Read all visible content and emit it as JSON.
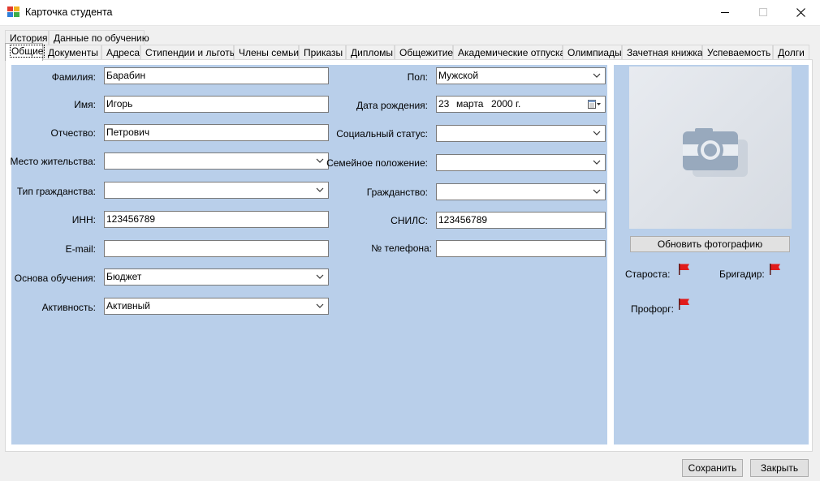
{
  "window": {
    "title": "Карточка студента",
    "colors": {
      "panel_bg": "#b9cfea",
      "window_bg": "#f0f0f0"
    }
  },
  "tabs_top": [
    "История",
    "Данные по обучению"
  ],
  "tabs_main": [
    "Общие",
    "Документы",
    "Адреса",
    "Стипендии и льготы",
    "Члены семьи",
    "Приказы",
    "Дипломы",
    "Общежитие",
    "Академические отпуска",
    "Олимпиады",
    "Зачетная книжка",
    "Успеваемость",
    "Долги"
  ],
  "active_tab": "Общие",
  "form": {
    "surname": {
      "label": "Фамилия:",
      "value": "Барабин"
    },
    "name": {
      "label": "Имя:",
      "value": "Игорь"
    },
    "patronymic": {
      "label": "Отчество:",
      "value": "Петрович"
    },
    "residence": {
      "label": "Место жительства:",
      "value": ""
    },
    "citizenship_type": {
      "label": "Тип гражданства:",
      "value": ""
    },
    "inn": {
      "label": "ИНН:",
      "value": "123456789"
    },
    "email": {
      "label": "E-mail:",
      "value": ""
    },
    "study_basis": {
      "label": "Основа обучения:",
      "value": "Бюджет"
    },
    "activity": {
      "label": "Активность:",
      "value": "Активный"
    },
    "gender": {
      "label": "Пол:",
      "value": "Мужской"
    },
    "birth_date": {
      "label": "Дата рождения:",
      "day": "23",
      "month": "марта",
      "year": "2000 г."
    },
    "social_status": {
      "label": "Социальный статус:",
      "value": ""
    },
    "marital_status": {
      "label": "Семейное положение:",
      "value": ""
    },
    "citizenship": {
      "label": "Гражданство:",
      "value": ""
    },
    "snils": {
      "label": "СНИЛС:",
      "value": "123456789"
    },
    "phone": {
      "label": "№ телефона:",
      "value": ""
    }
  },
  "photo": {
    "update_button": "Обновить фотографию",
    "icon": "camera-icon"
  },
  "roles": {
    "headman": "Староста:",
    "brigadier": "Бригадир:",
    "union_organizer": "Профорг:",
    "flag_color": "#e11b1b"
  },
  "buttons": {
    "save": "Сохранить",
    "close": "Закрыть"
  }
}
